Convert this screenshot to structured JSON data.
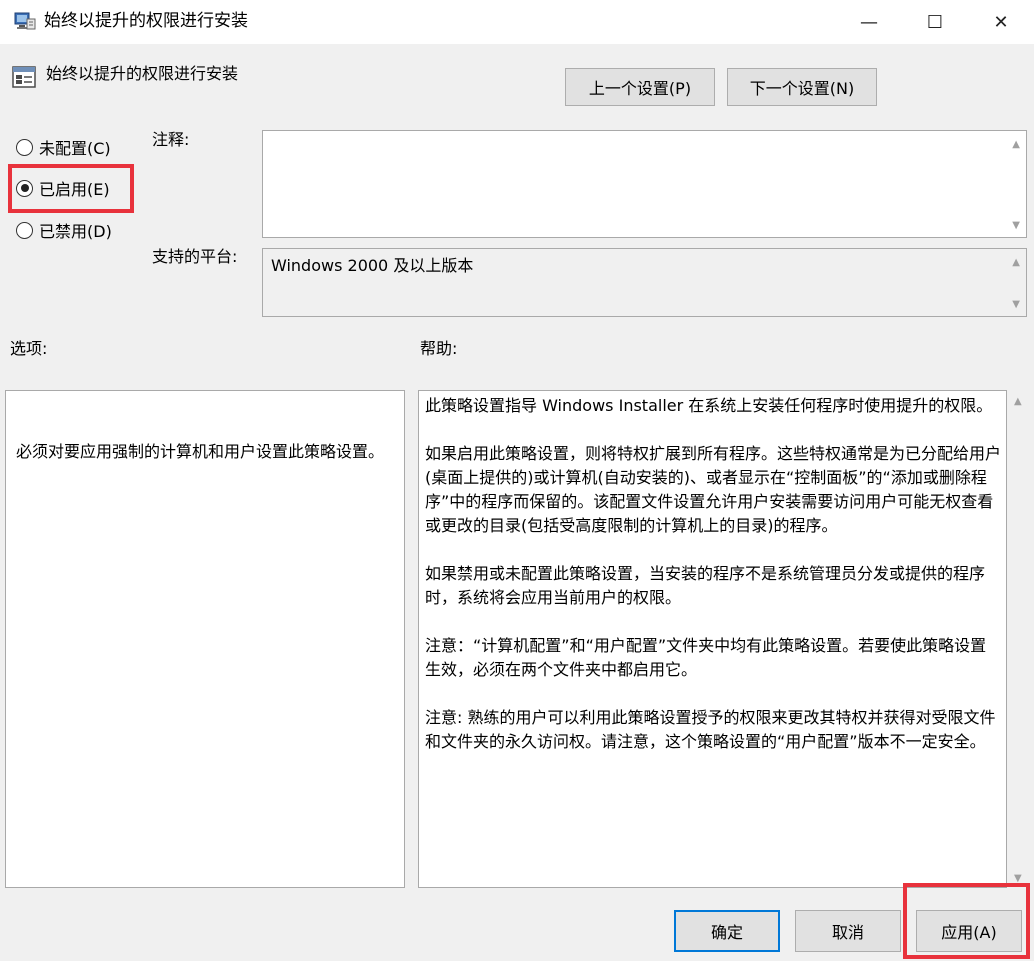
{
  "window": {
    "title": "始终以提升的权限进行安装",
    "minimize_glyph": "—",
    "maximize_glyph": "☐",
    "close_glyph": "✕"
  },
  "header": {
    "policy_title": "始终以提升的权限进行安装",
    "prev_button": "上一个设置(P)",
    "next_button": "下一个设置(N)"
  },
  "state": {
    "options": [
      {
        "label": "未配置(C)",
        "checked": false
      },
      {
        "label": "已启用(E)",
        "checked": true
      },
      {
        "label": "已禁用(D)",
        "checked": false
      }
    ]
  },
  "comment": {
    "label": "注释:",
    "value": ""
  },
  "platform": {
    "label": "支持的平台:",
    "value": "Windows 2000 及以上版本"
  },
  "options_section": {
    "label": "选项:",
    "text": "必须对要应用强制的计算机和用户设置此策略设置。"
  },
  "help_section": {
    "label": "帮助:",
    "paragraphs": [
      "此策略设置指导 Windows Installer 在系统上安装任何程序时使用提升的权限。",
      "如果启用此策略设置，则将特权扩展到所有程序。这些特权通常是为已分配给用户(桌面上提供的)或计算机(自动安装的)、或者显示在“控制面板”的“添加或删除程序”中的程序而保留的。该配置文件设置允许用户安装需要访问用户可能无权查看或更改的目录(包括受高度限制的计算机上的目录)的程序。",
      "如果禁用或未配置此策略设置，当安装的程序不是系统管理员分发或提供的程序时，系统将会应用当前用户的权限。",
      "注意：“计算机配置”和“用户配置”文件夹中均有此策略设置。若要使此策略设置生效，必须在两个文件夹中都启用它。",
      "注意: 熟练的用户可以利用此策略设置授予的权限来更改其特权并获得对受限文件和文件夹的永久访问权。请注意，这个策略设置的“用户配置”版本不一定安全。"
    ]
  },
  "footer": {
    "ok_button": "确定",
    "cancel_button": "取消",
    "apply_button": "应用(A)"
  },
  "colors": {
    "highlight": "#e8323c",
    "focus_border": "#0078d7"
  }
}
